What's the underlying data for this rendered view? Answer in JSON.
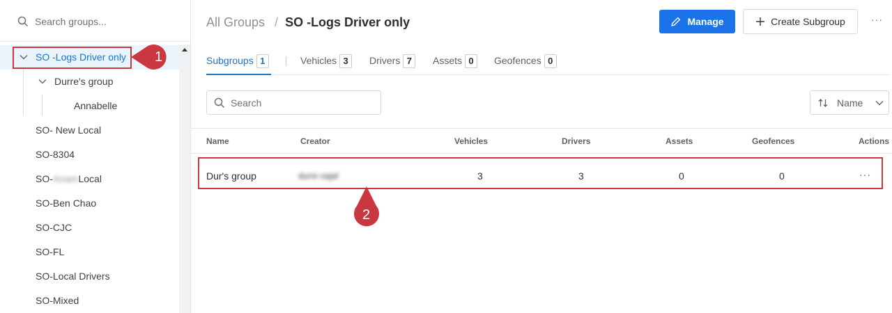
{
  "sidebar": {
    "search_placeholder": "Search groups...",
    "items": [
      {
        "label": "SO -Logs Driver only"
      },
      {
        "label": "Durre's group"
      },
      {
        "label": "Annabelle"
      },
      {
        "label": "SO- New Local"
      },
      {
        "label": "SO-8304"
      },
      {
        "label_prefix": "SO-",
        "label_redacted": "Anam",
        "label_suffix": "Local"
      },
      {
        "label": "SO-Ben Chao"
      },
      {
        "label": "SO-CJC"
      },
      {
        "label": "SO-FL"
      },
      {
        "label": "SO-Local Drivers"
      },
      {
        "label": "SO-Mixed"
      }
    ]
  },
  "breadcrumb": {
    "root": "All Groups",
    "separator": "/",
    "current": "SO -Logs Driver only"
  },
  "header": {
    "manage_label": "Manage",
    "create_label": "Create Subgroup",
    "more": "···"
  },
  "tabs": [
    {
      "label": "Subgroups",
      "count": "1"
    },
    {
      "label": "Vehicles",
      "count": "3"
    },
    {
      "label": "Drivers",
      "count": "7"
    },
    {
      "label": "Assets",
      "count": "0"
    },
    {
      "label": "Geofences",
      "count": "0"
    }
  ],
  "search": {
    "placeholder": "Search"
  },
  "sort": {
    "label": "Name"
  },
  "table": {
    "columns": [
      "Name",
      "Creator",
      "Vehicles",
      "Drivers",
      "Assets",
      "Geofences",
      "Actions"
    ],
    "rows": [
      {
        "name": "Dur's group",
        "creator": "durre najaf",
        "vehicles": "3",
        "drivers": "3",
        "assets": "0",
        "geofences": "0",
        "actions": "···"
      }
    ]
  },
  "callouts": {
    "marker1": "1",
    "marker2": "2",
    "color": "#c9383f"
  },
  "colors": {
    "accent": "#1a73e8",
    "selected_bg": "#eaf4fc",
    "callout": "#c9383f"
  }
}
